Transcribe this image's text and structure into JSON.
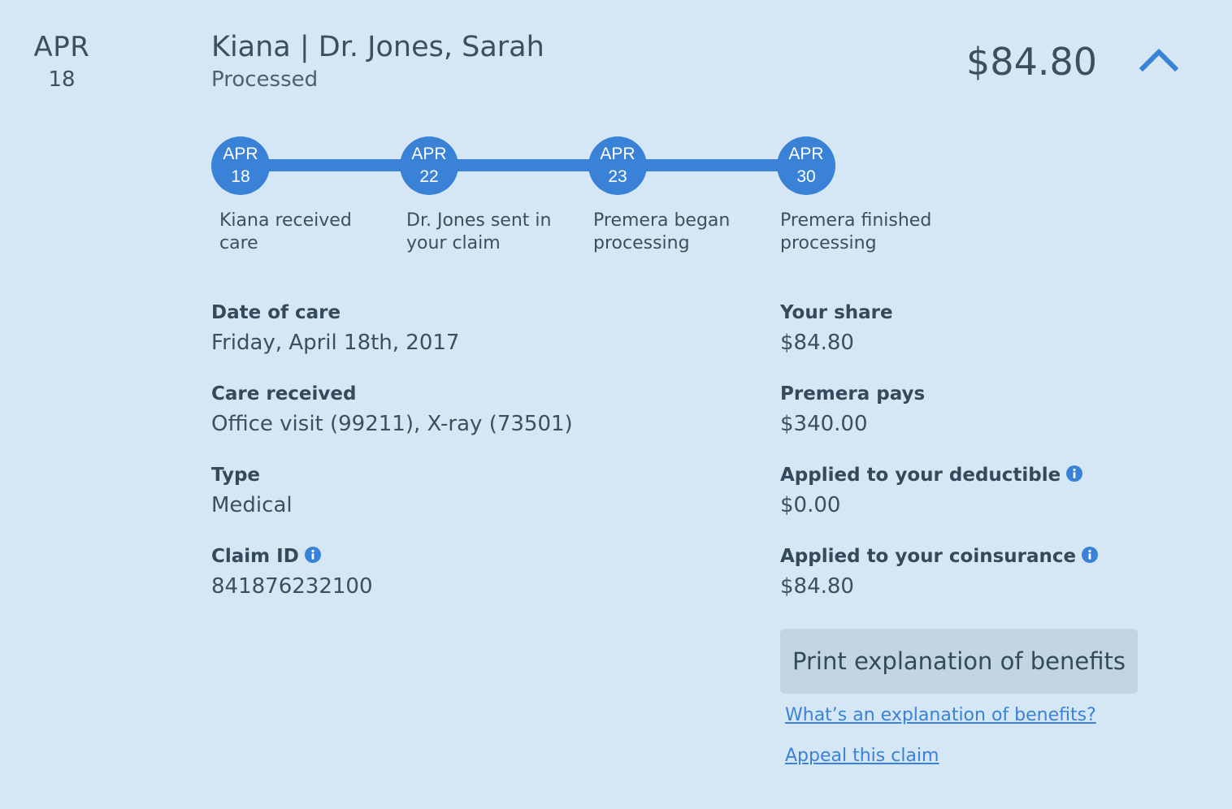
{
  "date": {
    "month": "APR",
    "day": "18"
  },
  "header": {
    "title": "Kiana | Dr. Jones, Sarah",
    "status": "Processed",
    "amount": "$84.80",
    "collapse_icon": "chevron-up-icon"
  },
  "colors": {
    "accent": "#3a82d8",
    "background": "#d5e7f5",
    "button_bg": "#c2d5e3",
    "text": "#34495a"
  },
  "timeline": [
    {
      "month": "APR",
      "day": "18",
      "label": "Kiana received care"
    },
    {
      "month": "APR",
      "day": "22",
      "label": "Dr. Jones sent in your claim"
    },
    {
      "month": "APR",
      "day": "23",
      "label": "Premera began processing"
    },
    {
      "month": "APR",
      "day": "30",
      "label": "Premera finished processing"
    }
  ],
  "details_left": [
    {
      "label": "Date of care",
      "value": "Friday, April 18th, 2017"
    },
    {
      "label": "Care received",
      "value": "Office visit (99211), X-ray (73501)"
    },
    {
      "label": "Type",
      "value": "Medical"
    },
    {
      "label": "Claim ID",
      "value": "841876232100",
      "info_icon": "info-icon"
    }
  ],
  "details_right": [
    {
      "label": "Your share",
      "value": "$84.80"
    },
    {
      "label": "Premera pays",
      "value": "$340.00"
    },
    {
      "label": "Applied to your deductible",
      "value": "$0.00",
      "info_icon": "info-icon"
    },
    {
      "label": "Applied to your coinsurance",
      "value": "$84.80",
      "info_icon": "info-icon"
    }
  ],
  "actions": {
    "print_label": "Print explanation of benefits",
    "eob_link": "What’s an explanation of benefits?",
    "appeal_link": "Appeal this claim"
  }
}
